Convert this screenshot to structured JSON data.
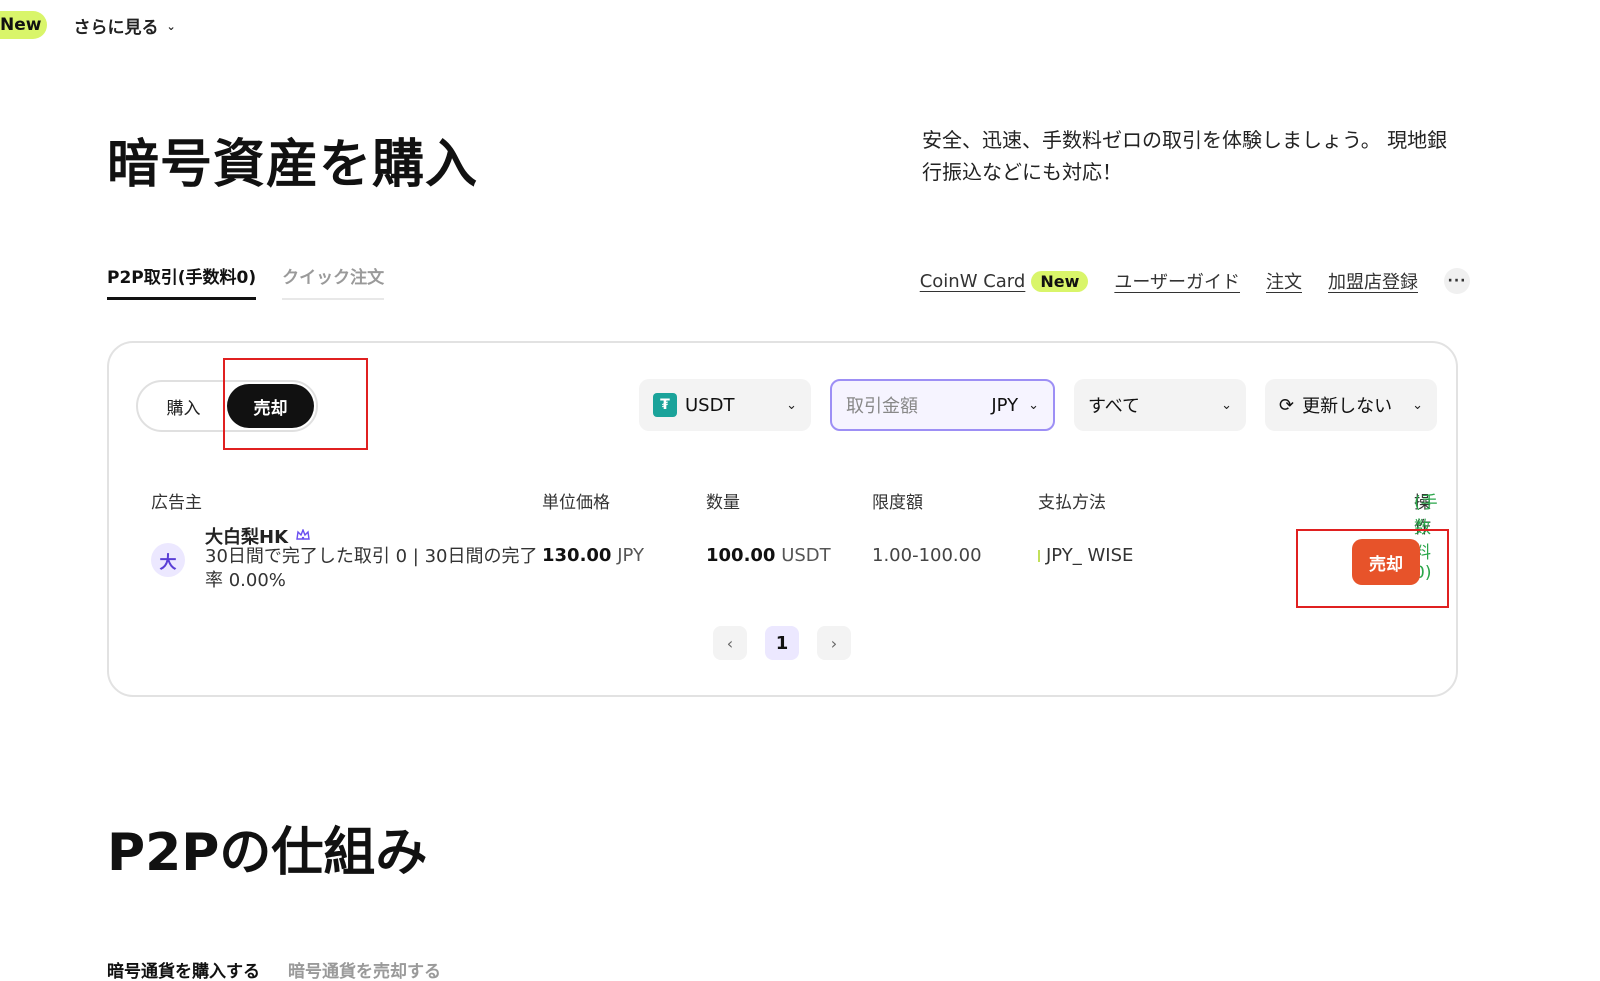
{
  "topnav": {
    "new_badge": "New",
    "see_more": "さらに見る"
  },
  "hero": {
    "title": "暗号資産を購入",
    "description": "安全、迅速、手数料ゼロの取引を体験しましょう。 現地銀行振込などにも対応！"
  },
  "tabs": [
    {
      "label": "P2P取引(手数料0)",
      "active": true
    },
    {
      "label": "クイック注文",
      "active": false
    }
  ],
  "links": {
    "card": "CoinW Card",
    "card_badge": "New",
    "guide": "ユーザーガイド",
    "orders": "注文",
    "merchant": "加盟店登録",
    "more": "···"
  },
  "panel": {
    "toggle": {
      "buy": "購入",
      "sell": "売却",
      "selected": "sell"
    },
    "filters": {
      "coin": "USDT",
      "amount_placeholder": "取引金額",
      "currency": "JPY",
      "payment": "すべて",
      "refresh": "更新しない"
    },
    "headers": {
      "advertiser": "広告主",
      "unit_price": "単位価格",
      "quantity": "数量",
      "limit": "限度額",
      "payment": "支払方法",
      "action": "操作",
      "action_fee": "(手数料0)"
    },
    "rows": [
      {
        "avatar": "大",
        "name": "大白梨HK",
        "stats": "30日間で完了した取引 0 | 30日間の完了率 0.00%",
        "price": "130.00",
        "price_unit": "JPY",
        "qty": "100.00",
        "qty_unit": "USDT",
        "limit": "1.00-100.00",
        "payment": "JPY_ WISE",
        "action": "売却"
      }
    ],
    "pagination": {
      "prev": "‹",
      "current": "1",
      "next": "›"
    }
  },
  "section": {
    "title": "P2Pの仕組み",
    "sub_tabs": [
      {
        "label": "暗号通貨を購入する",
        "active": true
      },
      {
        "label": "暗号通貨を売却する",
        "active": false
      }
    ]
  },
  "colors": {
    "accent_lime": "#d9f56a",
    "sell_button": "#e7532a",
    "fee_green": "#2aa64a",
    "amount_border": "#9d8ff5",
    "highlight_red": "#e02020"
  }
}
